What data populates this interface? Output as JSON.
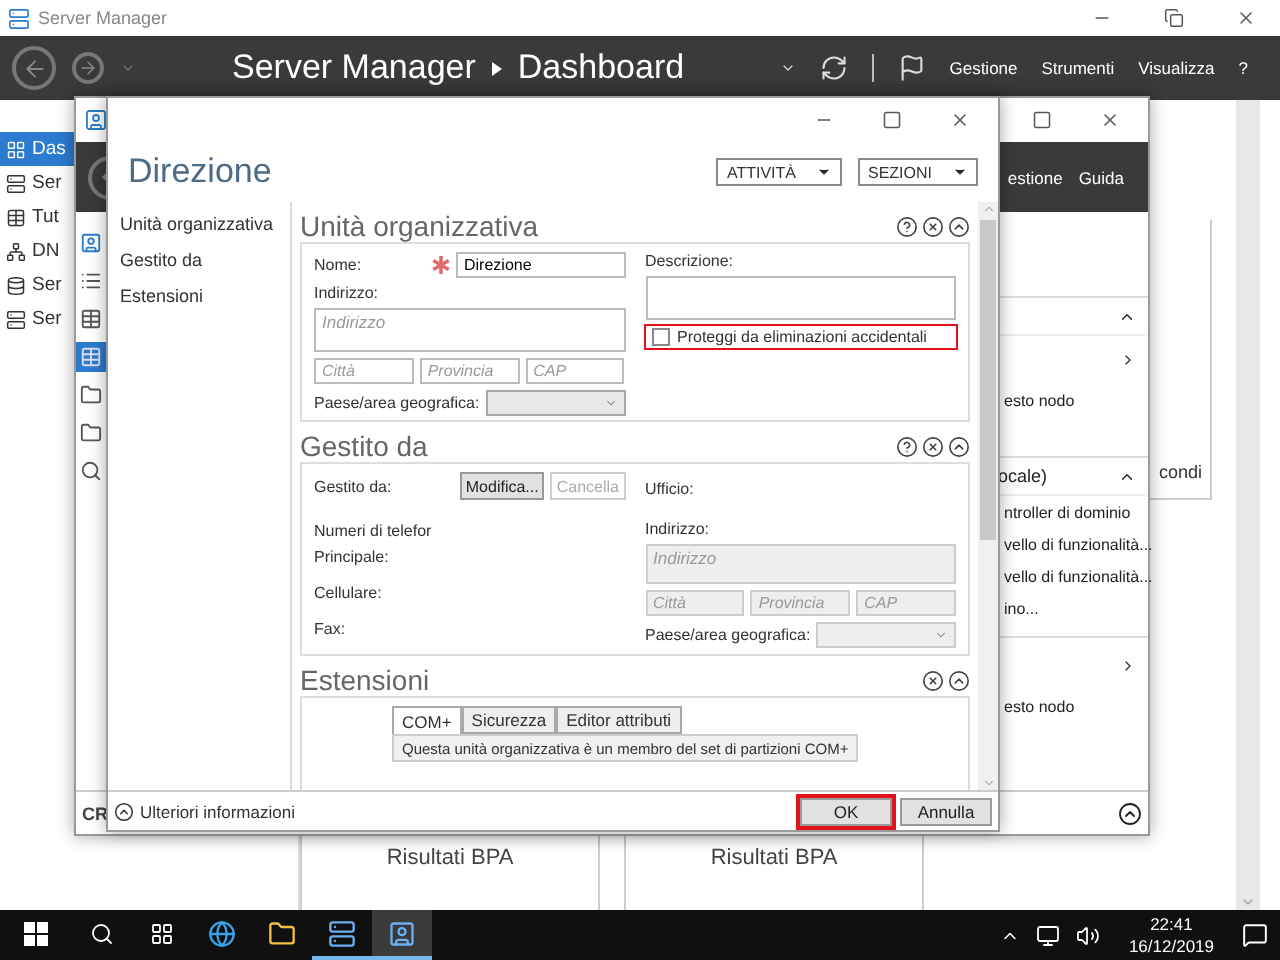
{
  "server_manager": {
    "title": "Server Manager",
    "breadcrumb": [
      "Server Manager",
      "Dashboard"
    ],
    "menu": [
      "Gestione",
      "Strumenti",
      "Visualizza",
      "?"
    ],
    "sidebar": [
      {
        "label": "Das",
        "selected": true
      },
      {
        "label": "Ser",
        "selected": false
      },
      {
        "label": "Tut",
        "selected": false
      },
      {
        "label": "DN",
        "selected": false
      },
      {
        "label": "Ser",
        "selected": false
      },
      {
        "label": "Ser",
        "selected": false
      }
    ],
    "card_text": "condi",
    "tiles": [
      "Risultati BPA",
      "Risultati BPA"
    ]
  },
  "admin_center": {
    "menu": [
      "estione",
      "Guida"
    ],
    "nav": [
      {
        "selected": false
      },
      {
        "selected": false
      },
      {
        "selected": false
      },
      {
        "selected": true
      },
      {
        "selected": false
      },
      {
        "selected": false
      },
      {
        "selected": false
      }
    ],
    "tasks": [
      {
        "kind": "header"
      },
      {
        "kind": "submenu"
      },
      {
        "kind": "link",
        "label": "esto nodo"
      },
      {
        "kind": "header",
        "label": "ocale)"
      },
      {
        "kind": "link",
        "label": "ntroller di dominio"
      },
      {
        "kind": "link",
        "label": "vello di funzionalità..."
      },
      {
        "kind": "link",
        "label": "vello di funzionalità..."
      },
      {
        "kind": "link",
        "label": "ino..."
      },
      {
        "kind": "divider"
      },
      {
        "kind": "submenu"
      },
      {
        "kind": "link",
        "label": "esto nodo"
      }
    ],
    "footer": "CR"
  },
  "dialog": {
    "title": "Direzione",
    "actions": [
      "ATTIVITÀ",
      "SEZIONI"
    ],
    "nav": [
      "Unità organizzativa",
      "Gestito da",
      "Estensioni"
    ],
    "organizational_unit": {
      "title": "Unità organizzativa",
      "help": true,
      "name_label": "Nome:",
      "name_value": "Direzione",
      "address_label": "Indirizzo:",
      "address_placeholder": "Indirizzo",
      "city_placeholder": "Città",
      "province_placeholder": "Provincia",
      "zip_placeholder": "CAP",
      "country_label": "Paese/area geografica:",
      "description_label": "Descrizione:",
      "protect": {
        "label": "Proteggi da eliminazioni accidentali",
        "checked": false,
        "highlighted": true
      }
    },
    "managed_by": {
      "title": "Gestito da",
      "help": true,
      "managed_by_label": "Gestito da:",
      "buttons": [
        {
          "label": "Modifica...",
          "disabled": false
        },
        {
          "label": "Cancella",
          "disabled": true
        }
      ],
      "phone_heading": "Numeri di telefor",
      "phones": [
        "Principale:",
        "Cellulare:",
        "Fax:"
      ],
      "office_label": "Ufficio:",
      "address_label": "Indirizzo:",
      "address_placeholder": "Indirizzo",
      "city_placeholder": "Città",
      "province_placeholder": "Provincia",
      "zip_placeholder": "CAP",
      "country_label": "Paese/area geografica:",
      "office_address_disabled": true
    },
    "extensions": {
      "title": "Estensioni",
      "help": false,
      "tabs": [
        {
          "label": "COM+",
          "selected": true
        },
        {
          "label": "Sicurezza",
          "selected": false
        },
        {
          "label": "Editor attributi",
          "selected": false
        }
      ],
      "text": "Questa unità organizzativa è un membro del set di partizioni COM+"
    },
    "more_info": "Ulteriori informazioni",
    "buttons": [
      {
        "label": "OK",
        "highlighted": true
      },
      {
        "label": "Annulla",
        "highlighted": false
      }
    ]
  },
  "taskbar": {
    "apps": [
      {
        "running": false,
        "active": false
      },
      {
        "running": false,
        "active": false
      },
      {
        "running": true,
        "active": false
      },
      {
        "running": true,
        "active": true
      }
    ],
    "time": "22:41",
    "date": "16/12/2019"
  }
}
